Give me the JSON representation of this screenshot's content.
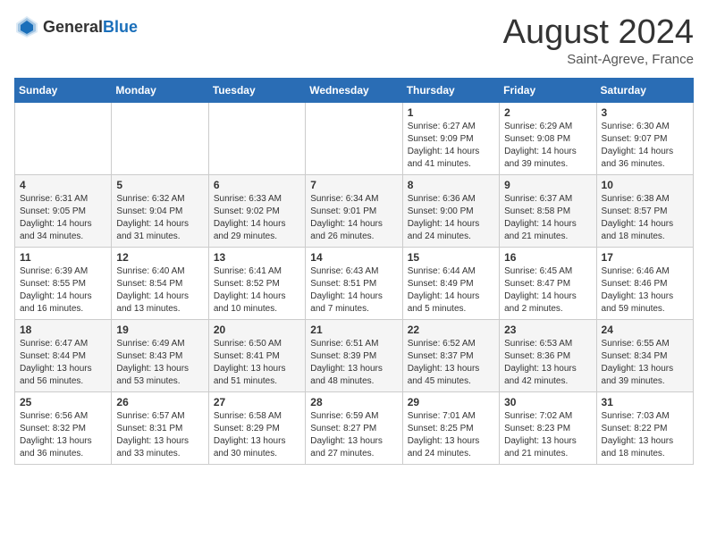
{
  "logo": {
    "text_general": "General",
    "text_blue": "Blue"
  },
  "header": {
    "month": "August 2024",
    "location": "Saint-Agreve, France"
  },
  "weekdays": [
    "Sunday",
    "Monday",
    "Tuesday",
    "Wednesday",
    "Thursday",
    "Friday",
    "Saturday"
  ],
  "weeks": [
    [
      {
        "day": "",
        "sunrise": "",
        "sunset": "",
        "daylight": ""
      },
      {
        "day": "",
        "sunrise": "",
        "sunset": "",
        "daylight": ""
      },
      {
        "day": "",
        "sunrise": "",
        "sunset": "",
        "daylight": ""
      },
      {
        "day": "",
        "sunrise": "",
        "sunset": "",
        "daylight": ""
      },
      {
        "day": "1",
        "sunrise": "Sunrise: 6:27 AM",
        "sunset": "Sunset: 9:09 PM",
        "daylight": "Daylight: 14 hours and 41 minutes."
      },
      {
        "day": "2",
        "sunrise": "Sunrise: 6:29 AM",
        "sunset": "Sunset: 9:08 PM",
        "daylight": "Daylight: 14 hours and 39 minutes."
      },
      {
        "day": "3",
        "sunrise": "Sunrise: 6:30 AM",
        "sunset": "Sunset: 9:07 PM",
        "daylight": "Daylight: 14 hours and 36 minutes."
      }
    ],
    [
      {
        "day": "4",
        "sunrise": "Sunrise: 6:31 AM",
        "sunset": "Sunset: 9:05 PM",
        "daylight": "Daylight: 14 hours and 34 minutes."
      },
      {
        "day": "5",
        "sunrise": "Sunrise: 6:32 AM",
        "sunset": "Sunset: 9:04 PM",
        "daylight": "Daylight: 14 hours and 31 minutes."
      },
      {
        "day": "6",
        "sunrise": "Sunrise: 6:33 AM",
        "sunset": "Sunset: 9:02 PM",
        "daylight": "Daylight: 14 hours and 29 minutes."
      },
      {
        "day": "7",
        "sunrise": "Sunrise: 6:34 AM",
        "sunset": "Sunset: 9:01 PM",
        "daylight": "Daylight: 14 hours and 26 minutes."
      },
      {
        "day": "8",
        "sunrise": "Sunrise: 6:36 AM",
        "sunset": "Sunset: 9:00 PM",
        "daylight": "Daylight: 14 hours and 24 minutes."
      },
      {
        "day": "9",
        "sunrise": "Sunrise: 6:37 AM",
        "sunset": "Sunset: 8:58 PM",
        "daylight": "Daylight: 14 hours and 21 minutes."
      },
      {
        "day": "10",
        "sunrise": "Sunrise: 6:38 AM",
        "sunset": "Sunset: 8:57 PM",
        "daylight": "Daylight: 14 hours and 18 minutes."
      }
    ],
    [
      {
        "day": "11",
        "sunrise": "Sunrise: 6:39 AM",
        "sunset": "Sunset: 8:55 PM",
        "daylight": "Daylight: 14 hours and 16 minutes."
      },
      {
        "day": "12",
        "sunrise": "Sunrise: 6:40 AM",
        "sunset": "Sunset: 8:54 PM",
        "daylight": "Daylight: 14 hours and 13 minutes."
      },
      {
        "day": "13",
        "sunrise": "Sunrise: 6:41 AM",
        "sunset": "Sunset: 8:52 PM",
        "daylight": "Daylight: 14 hours and 10 minutes."
      },
      {
        "day": "14",
        "sunrise": "Sunrise: 6:43 AM",
        "sunset": "Sunset: 8:51 PM",
        "daylight": "Daylight: 14 hours and 7 minutes."
      },
      {
        "day": "15",
        "sunrise": "Sunrise: 6:44 AM",
        "sunset": "Sunset: 8:49 PM",
        "daylight": "Daylight: 14 hours and 5 minutes."
      },
      {
        "day": "16",
        "sunrise": "Sunrise: 6:45 AM",
        "sunset": "Sunset: 8:47 PM",
        "daylight": "Daylight: 14 hours and 2 minutes."
      },
      {
        "day": "17",
        "sunrise": "Sunrise: 6:46 AM",
        "sunset": "Sunset: 8:46 PM",
        "daylight": "Daylight: 13 hours and 59 minutes."
      }
    ],
    [
      {
        "day": "18",
        "sunrise": "Sunrise: 6:47 AM",
        "sunset": "Sunset: 8:44 PM",
        "daylight": "Daylight: 13 hours and 56 minutes."
      },
      {
        "day": "19",
        "sunrise": "Sunrise: 6:49 AM",
        "sunset": "Sunset: 8:43 PM",
        "daylight": "Daylight: 13 hours and 53 minutes."
      },
      {
        "day": "20",
        "sunrise": "Sunrise: 6:50 AM",
        "sunset": "Sunset: 8:41 PM",
        "daylight": "Daylight: 13 hours and 51 minutes."
      },
      {
        "day": "21",
        "sunrise": "Sunrise: 6:51 AM",
        "sunset": "Sunset: 8:39 PM",
        "daylight": "Daylight: 13 hours and 48 minutes."
      },
      {
        "day": "22",
        "sunrise": "Sunrise: 6:52 AM",
        "sunset": "Sunset: 8:37 PM",
        "daylight": "Daylight: 13 hours and 45 minutes."
      },
      {
        "day": "23",
        "sunrise": "Sunrise: 6:53 AM",
        "sunset": "Sunset: 8:36 PM",
        "daylight": "Daylight: 13 hours and 42 minutes."
      },
      {
        "day": "24",
        "sunrise": "Sunrise: 6:55 AM",
        "sunset": "Sunset: 8:34 PM",
        "daylight": "Daylight: 13 hours and 39 minutes."
      }
    ],
    [
      {
        "day": "25",
        "sunrise": "Sunrise: 6:56 AM",
        "sunset": "Sunset: 8:32 PM",
        "daylight": "Daylight: 13 hours and 36 minutes."
      },
      {
        "day": "26",
        "sunrise": "Sunrise: 6:57 AM",
        "sunset": "Sunset: 8:31 PM",
        "daylight": "Daylight: 13 hours and 33 minutes."
      },
      {
        "day": "27",
        "sunrise": "Sunrise: 6:58 AM",
        "sunset": "Sunset: 8:29 PM",
        "daylight": "Daylight: 13 hours and 30 minutes."
      },
      {
        "day": "28",
        "sunrise": "Sunrise: 6:59 AM",
        "sunset": "Sunset: 8:27 PM",
        "daylight": "Daylight: 13 hours and 27 minutes."
      },
      {
        "day": "29",
        "sunrise": "Sunrise: 7:01 AM",
        "sunset": "Sunset: 8:25 PM",
        "daylight": "Daylight: 13 hours and 24 minutes."
      },
      {
        "day": "30",
        "sunrise": "Sunrise: 7:02 AM",
        "sunset": "Sunset: 8:23 PM",
        "daylight": "Daylight: 13 hours and 21 minutes."
      },
      {
        "day": "31",
        "sunrise": "Sunrise: 7:03 AM",
        "sunset": "Sunset: 8:22 PM",
        "daylight": "Daylight: 13 hours and 18 minutes."
      }
    ]
  ]
}
